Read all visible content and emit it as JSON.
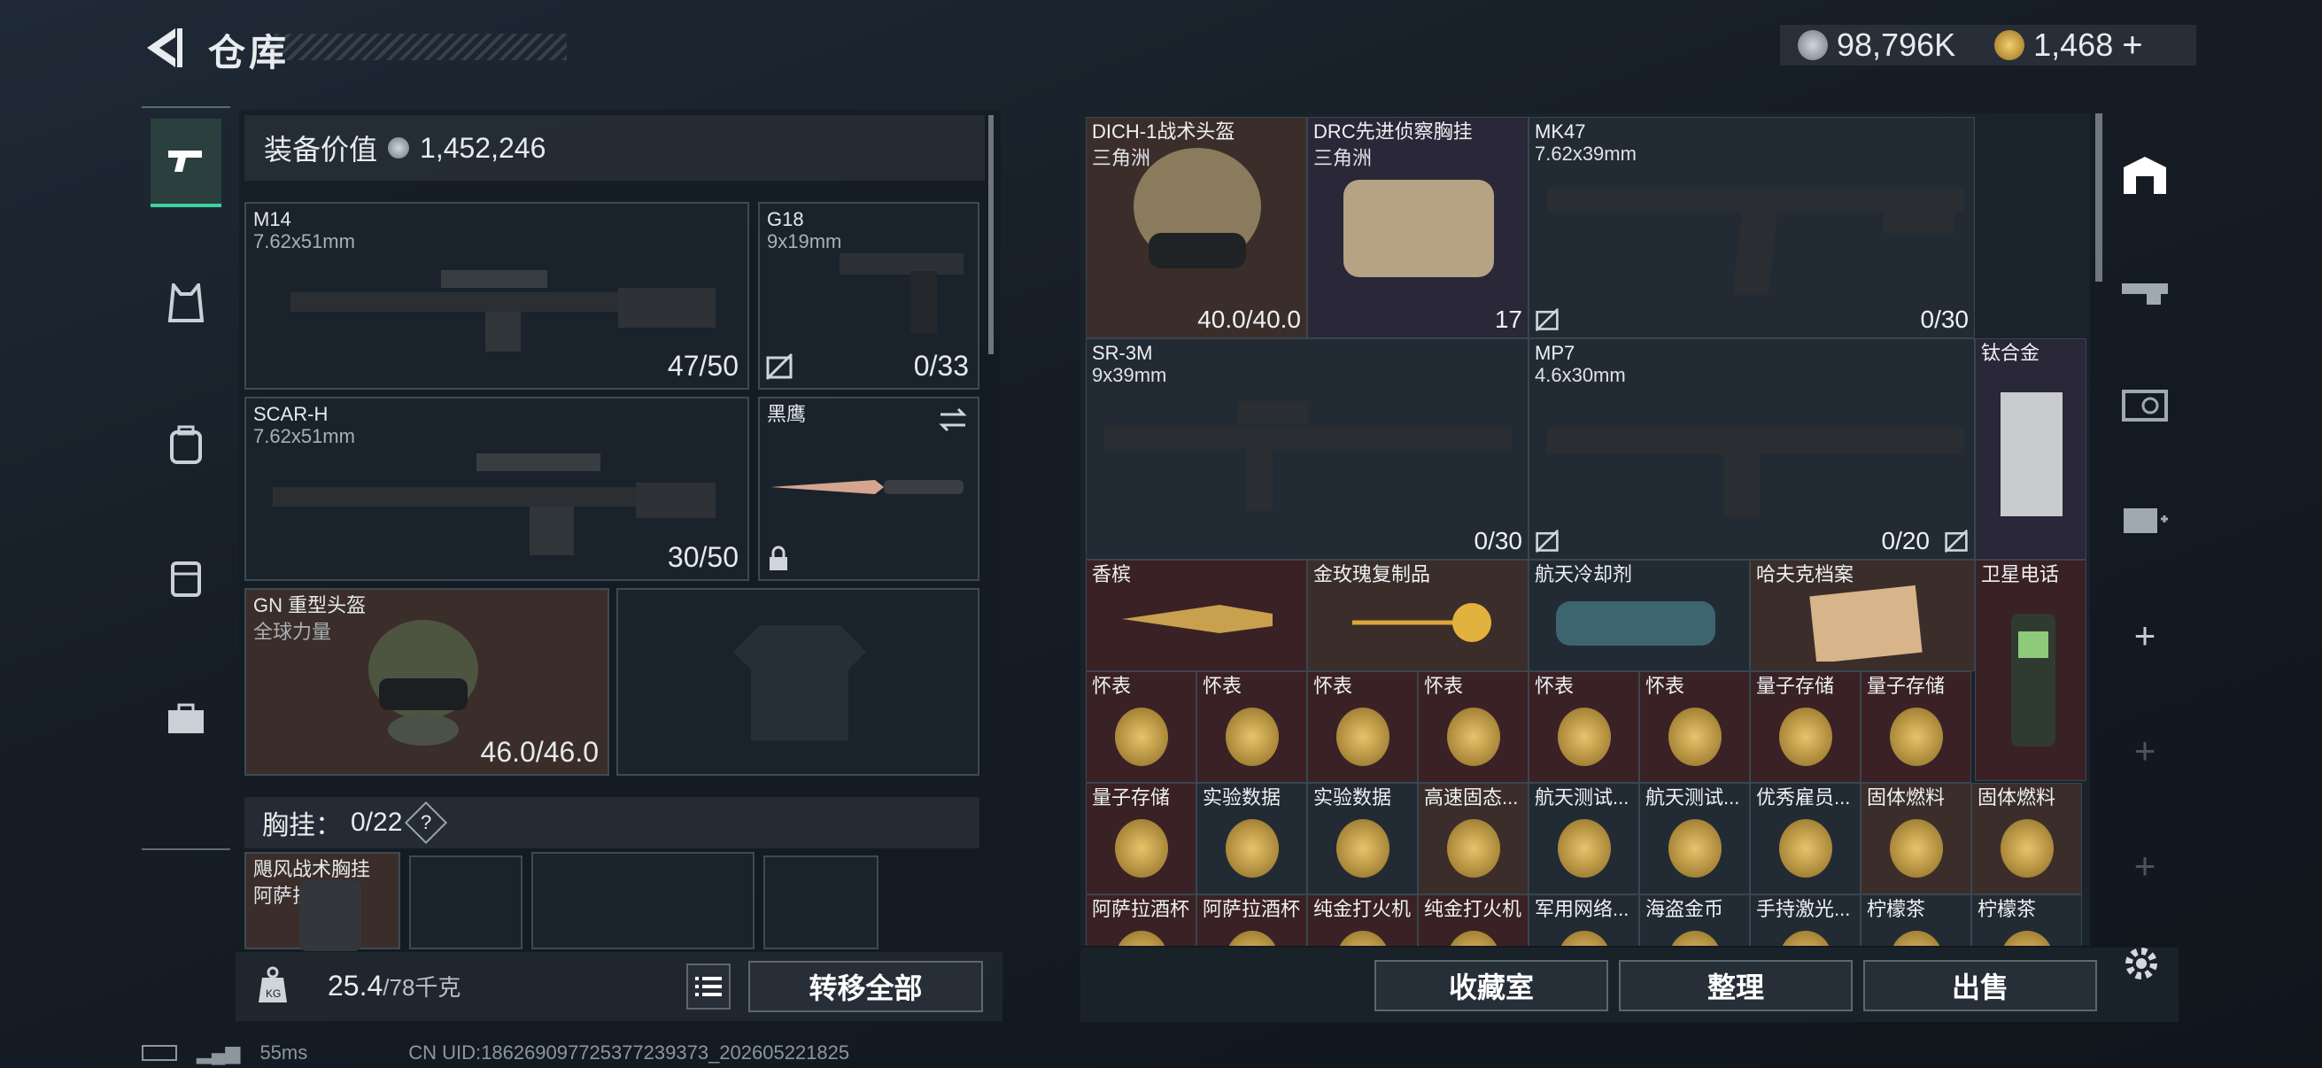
{
  "header": {
    "title": "仓库",
    "currency_silver": "98,796K",
    "currency_gold": "1,468",
    "add_symbol": "+"
  },
  "left_panel": {
    "value_label": "装备价值",
    "value": "1,452,246",
    "slots": [
      {
        "name": "M14",
        "sub": "7.62x51mm",
        "count": "47/50"
      },
      {
        "name": "G18",
        "sub": "9x19mm",
        "count": "0/33"
      },
      {
        "name": "SCAR-H",
        "sub": "7.62x51mm",
        "count": "30/50"
      },
      {
        "name": "黑鹰",
        "sub": "",
        "count": ""
      },
      {
        "name": "GN 重型头盔",
        "sub": "全球力量",
        "count": "46.0/46.0"
      }
    ],
    "chest_label": "胸挂：",
    "chest_value": "0/22",
    "chest_help": "?",
    "chest_item": {
      "name": "飓风战术胸挂",
      "sub": "阿萨拉"
    },
    "weight_value": "25.4",
    "weight_max": "/78千克",
    "transfer_all": "转移全部",
    "kg_label": "KG"
  },
  "grid": {
    "items": [
      {
        "name": "DICH-1战术头盔",
        "sub": "三角洲",
        "count": "40.0/40.0"
      },
      {
        "name": "DRC先进侦察胸挂",
        "sub": "三角洲",
        "count": "17"
      },
      {
        "name": "MK47",
        "sub": "7.62x39mm",
        "count": "0/30"
      },
      {
        "name": "SR-3M",
        "sub": "9x39mm",
        "count": "0/30"
      },
      {
        "name": "MP7",
        "sub": "4.6x30mm",
        "count": "0/20"
      },
      {
        "name": "钛合金",
        "sub": "",
        "count": ""
      },
      {
        "name": "香槟"
      },
      {
        "name": "金玫瑰复制品"
      },
      {
        "name": "航天冷却剂"
      },
      {
        "name": "哈夫克档案"
      },
      {
        "name": "卫星电话"
      },
      {
        "name": "怀表"
      },
      {
        "name": "怀表"
      },
      {
        "name": "怀表"
      },
      {
        "name": "怀表"
      },
      {
        "name": "怀表"
      },
      {
        "name": "怀表"
      },
      {
        "name": "量子存储"
      },
      {
        "name": "量子存储"
      },
      {
        "name": "量子存储"
      },
      {
        "name": "实验数据"
      },
      {
        "name": "实验数据"
      },
      {
        "name": "高速固态..."
      },
      {
        "name": "航天测试..."
      },
      {
        "name": "航天测试..."
      },
      {
        "name": "优秀雇员..."
      },
      {
        "name": "固体燃料"
      },
      {
        "name": "固体燃料"
      },
      {
        "name": "阿萨拉酒杯"
      },
      {
        "name": "阿萨拉酒杯"
      },
      {
        "name": "纯金打火机"
      },
      {
        "name": "纯金打火机"
      },
      {
        "name": "军用网络..."
      },
      {
        "name": "海盗金币"
      },
      {
        "name": "手持激光..."
      },
      {
        "name": "柠檬茶"
      },
      {
        "name": "柠檬茶"
      }
    ]
  },
  "bottom_buttons": {
    "collection": "收藏室",
    "organize": "整理",
    "sell": "出售"
  },
  "status": {
    "ping": "55ms",
    "uid": "CN UID:186269097725377239373_202605221825"
  },
  "icons": [
    "back-arrow-icon",
    "pistol-icon",
    "vest-icon",
    "backpack-icon",
    "pouch-icon",
    "toolbox-icon",
    "storage-icon",
    "weapon-rack-icon",
    "vault-icon",
    "medical-icon",
    "plus-icon",
    "gear-icon",
    "list-icon",
    "swap-icon",
    "lock-icon",
    "no-ammo-icon"
  ]
}
